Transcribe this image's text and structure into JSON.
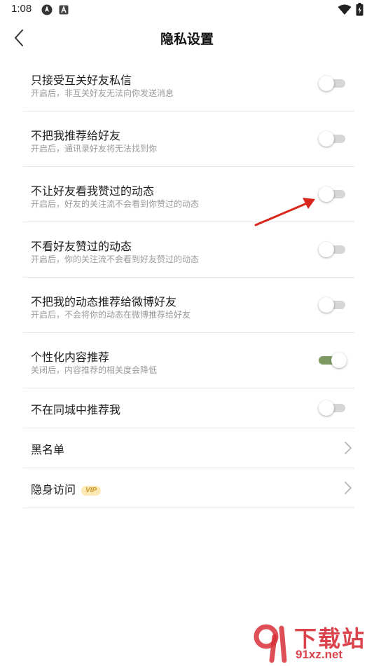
{
  "status": {
    "time": "1:08",
    "icons": [
      "location-icon",
      "a-icon",
      "wifi-icon",
      "battery-icon"
    ]
  },
  "header": {
    "back_icon": "chevron-left-icon",
    "title": "隐私设置"
  },
  "settings": [
    {
      "title": "只接受互关好友私信",
      "subtitle": "开启后，非互关好友无法向你发送消息",
      "type": "toggle",
      "on": false
    },
    {
      "title": "不把我推荐给好友",
      "subtitle": "开启后，通讯录好友将无法找到你",
      "type": "toggle",
      "on": false
    },
    {
      "title": "不让好友看我赞过的动态",
      "subtitle": "开启后，好友的关注流不会看到你赞过的动态",
      "type": "toggle",
      "on": false
    },
    {
      "title": "不看好友赞过的动态",
      "subtitle": "开启后，你的关注流不会看到好友赞过的动态",
      "type": "toggle",
      "on": false
    },
    {
      "title": "不把我的动态推荐给微博好友",
      "subtitle": "开启后，不会将你的动态在微博推荐给好友",
      "type": "toggle",
      "on": false
    },
    {
      "title": "个性化内容推荐",
      "subtitle": "关闭后，内容推荐的相关度会降低",
      "type": "toggle",
      "on": true
    },
    {
      "title": "不在同城中推荐我",
      "type": "toggle",
      "on": false
    },
    {
      "title": "黑名单",
      "type": "link"
    },
    {
      "title": "隐身访问",
      "badge": "VIP",
      "type": "link"
    }
  ],
  "watermark": {
    "main": "下载站",
    "domain": "91xz.net"
  },
  "colors": {
    "toggle_on": "#7c9a62",
    "toggle_off": "#d6d6d6",
    "annotation_arrow": "#d9261c",
    "watermark": "#d8303a"
  }
}
